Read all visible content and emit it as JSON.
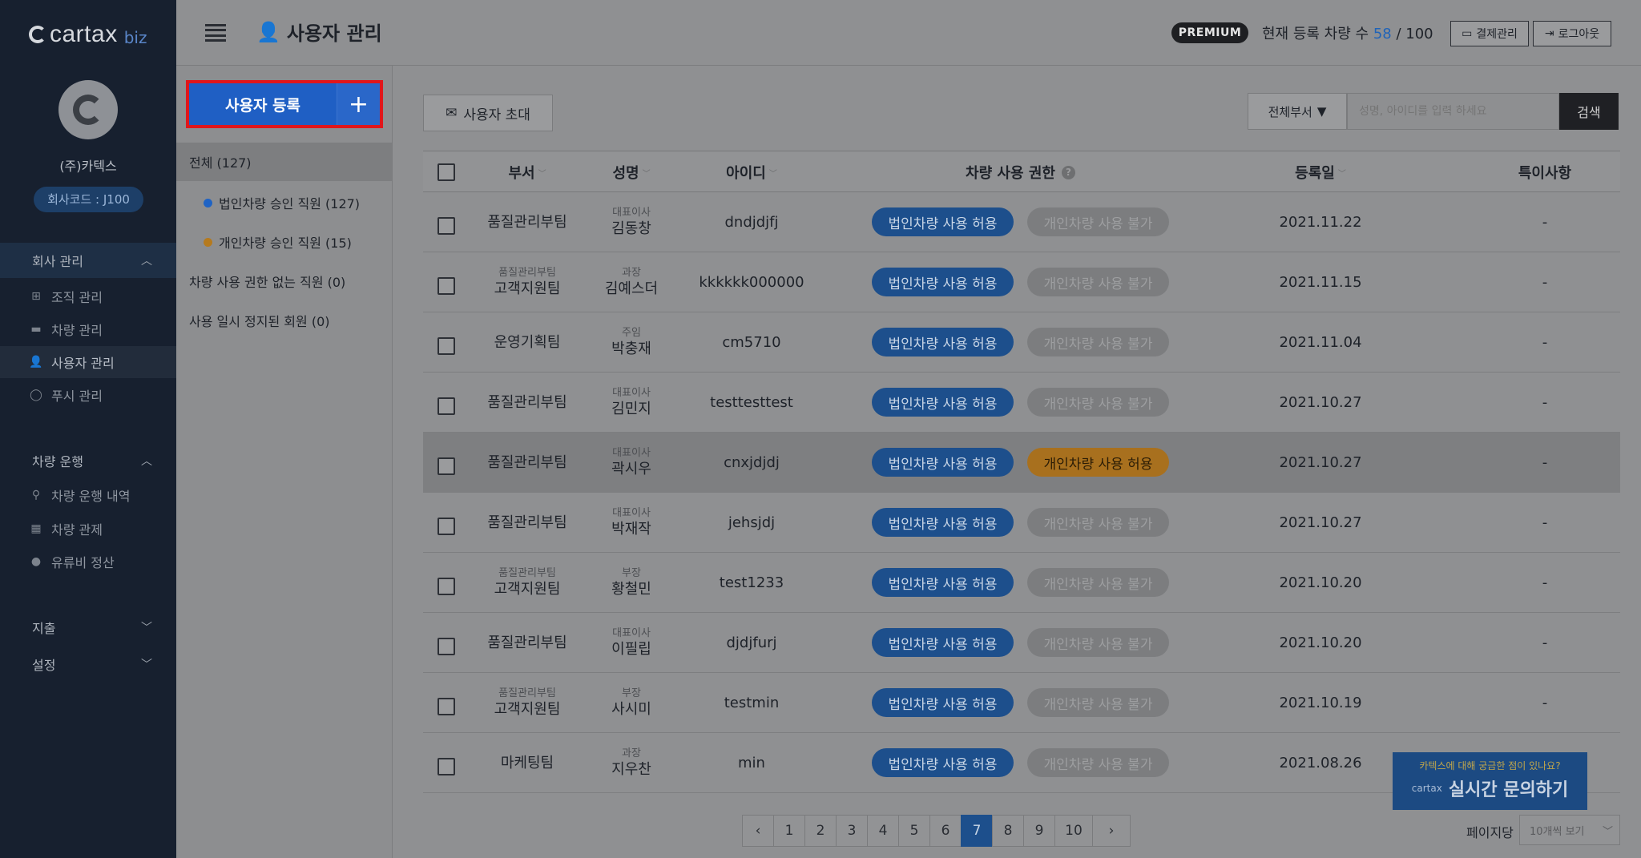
{
  "sidebar": {
    "logo_word": "cartax",
    "logo_suffix": "biz",
    "company_name": "(주)카텍스",
    "company_code": "회사코드 : J100",
    "sections": [
      {
        "label": "회사 관리",
        "chevron": "^"
      },
      {
        "label": "차량 운행",
        "chevron": "^"
      },
      {
        "label": "지출",
        "chevron": "v"
      },
      {
        "label": "설정",
        "chevron": "v"
      }
    ],
    "company_items": [
      {
        "label": "조직 관리",
        "icon": "org-chart-icon"
      },
      {
        "label": "차량 관리",
        "icon": "car-icon"
      },
      {
        "label": "사용자 관리",
        "icon": "user-add-icon"
      },
      {
        "label": "푸시 관리",
        "icon": "chat-bubble-icon"
      }
    ],
    "drive_items": [
      {
        "label": "차량 운행 내역",
        "icon": "location-pin-icon"
      },
      {
        "label": "차량 관제",
        "icon": "map-icon"
      },
      {
        "label": "유류비 정산",
        "icon": "fuel-drop-icon"
      }
    ]
  },
  "topbar": {
    "title": "사용자 관리",
    "premium": "PREMIUM",
    "reg_label": "현재 등록 차량 수",
    "reg_current": "58",
    "reg_sep": " / ",
    "reg_total": "100",
    "billing_btn": "결제관리",
    "logout_btn": "로그아웃"
  },
  "filters": {
    "register_btn": "사용자 등록",
    "all": "전체 (127)",
    "corp_approved": "법인차량 승인 직원 (127)",
    "personal_approved": "개인차량 승인 직원 (15)",
    "no_permission": "차량 사용 권한 없는 직원 (0)",
    "suspended": "사용 일시 정지된 회원 (0)",
    "corp_dot_color": "#1f63c4",
    "personal_dot_color": "#b57a1e"
  },
  "toolbar": {
    "invite_btn": "사용자 초대",
    "dept_select": "전체부서",
    "search_placeholder": "성명, 아이디를 입력 하세요",
    "search_btn": "검색"
  },
  "table": {
    "headers": {
      "dept": "부서",
      "name": "성명",
      "id": "아이디",
      "permission": "차량 사용 권한",
      "date": "등록일",
      "note": "특이사항"
    },
    "pill_corp": "법인차량 사용 허용",
    "pill_personal_no": "개인차량 사용 불가",
    "pill_personal_yes": "개인차량 사용 허용",
    "rows": [
      {
        "dept_top": "",
        "dept": "품질관리부팀",
        "title": "대표이사",
        "name": "김동창",
        "id": "dndjdjfj",
        "personal": "개인차량 사용 불가",
        "date": "2021.11.22",
        "note": "-"
      },
      {
        "dept_top": "품질관리부팀",
        "dept": "고객지원팀",
        "title": "과장",
        "name": "김예스더",
        "id": "kkkkkk000000",
        "personal": "개인차량 사용 불가",
        "date": "2021.11.15",
        "note": "-"
      },
      {
        "dept_top": "",
        "dept": "운영기획팀",
        "title": "주임",
        "name": "박충재",
        "id": "cm5710",
        "personal": "개인차량 사용 불가",
        "date": "2021.11.04",
        "note": "-"
      },
      {
        "dept_top": "",
        "dept": "품질관리부팀",
        "title": "대표이사",
        "name": "김민지",
        "id": "testtesttest",
        "personal": "개인차량 사용 불가",
        "date": "2021.10.27",
        "note": "-"
      },
      {
        "dept_top": "",
        "dept": "품질관리부팀",
        "title": "대표이사",
        "name": "곽시우",
        "id": "cnxjdjdj",
        "personal": "개인차량 사용 허용",
        "date": "2021.10.27",
        "note": "-"
      },
      {
        "dept_top": "",
        "dept": "품질관리부팀",
        "title": "대표이사",
        "name": "박재작",
        "id": "jehsjdj",
        "personal": "개인차량 사용 불가",
        "date": "2021.10.27",
        "note": "-"
      },
      {
        "dept_top": "품질관리부팀",
        "dept": "고객지원팀",
        "title": "부장",
        "name": "황철민",
        "id": "test1233",
        "personal": "개인차량 사용 불가",
        "date": "2021.10.20",
        "note": "-"
      },
      {
        "dept_top": "",
        "dept": "품질관리부팀",
        "title": "대표이사",
        "name": "이필립",
        "id": "djdjfurj",
        "personal": "개인차량 사용 불가",
        "date": "2021.10.20",
        "note": "-"
      },
      {
        "dept_top": "품질관리부팀",
        "dept": "고객지원팀",
        "title": "부장",
        "name": "사시미",
        "id": "testmin",
        "personal": "개인차량 사용 불가",
        "date": "2021.10.19",
        "note": "-"
      },
      {
        "dept_top": "",
        "dept": "마케팅팀",
        "title": "과장",
        "name": "지우찬",
        "id": "min",
        "personal": "개인차량 사용 불가",
        "date": "2021.08.26",
        "note": ""
      }
    ]
  },
  "pagination": {
    "prev": "‹",
    "next": "›",
    "pages": [
      "1",
      "2",
      "3",
      "4",
      "5",
      "6",
      "7",
      "8",
      "9",
      "10"
    ],
    "current": "7",
    "per_page_label": "페이지당",
    "per_page_value": "10개씩 보기"
  },
  "chat": {
    "question": "카텍스에 대해 궁금한 점이 있나요?",
    "brand": "cartax",
    "cta": "실시간 문의하기"
  }
}
